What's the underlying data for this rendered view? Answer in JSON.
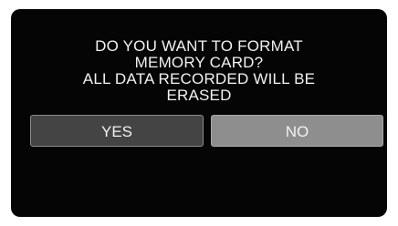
{
  "dialog": {
    "message_lines": [
      "DO YOU WANT TO FORMAT",
      "MEMORY CARD?",
      "ALL DATA RECORDED WILL BE",
      "ERASED"
    ],
    "yes_label": "YES",
    "no_label": "NO"
  },
  "colors": {
    "screen_background": "#050505",
    "text": "#f2f2f2",
    "yes_button": "#444444",
    "no_button": "#8e8e8e"
  }
}
